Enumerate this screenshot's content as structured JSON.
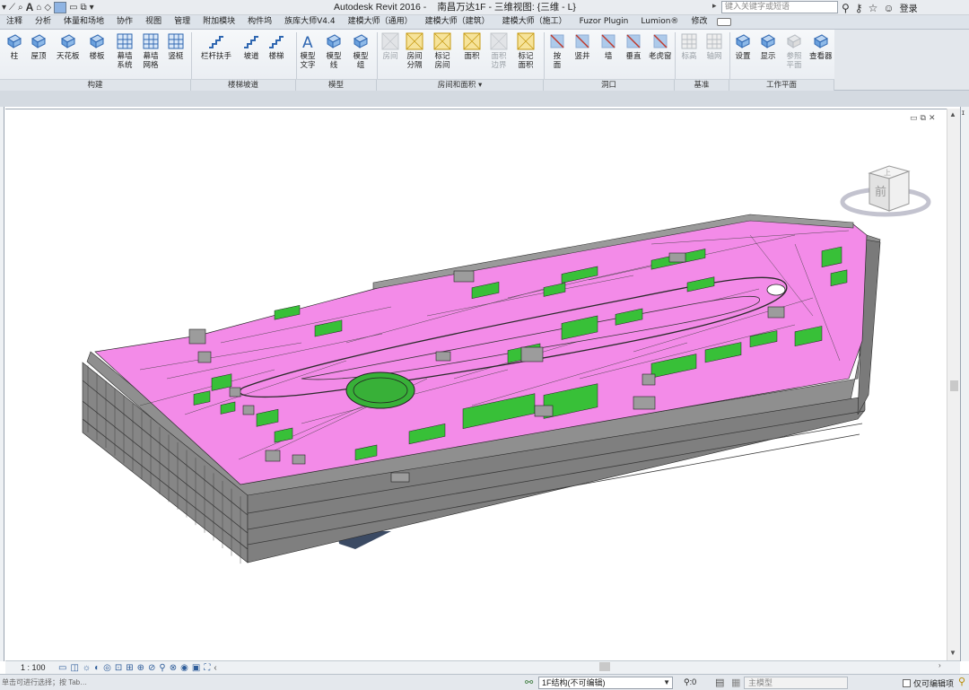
{
  "app": {
    "title": "Autodesk Revit 2016 -",
    "document": "南昌万达1F - 三维视图: {三维 - L}",
    "search_placeholder": "键入关键字或短语",
    "login_label": "登录"
  },
  "tabs": [
    "注释",
    "分析",
    "体量和场地",
    "协作",
    "视图",
    "管理",
    "附加模块",
    "构件坞",
    "族库大师V4.4",
    "建模大师（通用）",
    "建模大师（建筑）",
    "建模大师（施工）",
    "Fuzor Plugin",
    "Lumion®",
    "修改"
  ],
  "ribbon": {
    "tools": [
      {
        "label": "柱",
        "icon": "column-icon",
        "disabled": false
      },
      {
        "label": "屋顶",
        "icon": "roof-icon",
        "disabled": false
      },
      {
        "label": "天花板",
        "icon": "ceiling-icon",
        "disabled": false
      },
      {
        "label": "楼板",
        "icon": "floor-icon",
        "disabled": false
      },
      {
        "label": "幕墙\n系统",
        "icon": "curtain-system-icon",
        "disabled": false
      },
      {
        "label": "幕墙\n网格",
        "icon": "curtain-grid-icon",
        "disabled": false
      },
      {
        "label": "竖梃",
        "icon": "mullion-icon",
        "disabled": false
      },
      {
        "label": "栏杆扶手",
        "icon": "railing-icon",
        "disabled": false
      },
      {
        "label": "坡道",
        "icon": "ramp-icon",
        "disabled": false
      },
      {
        "label": "楼梯",
        "icon": "stair-icon",
        "disabled": false
      },
      {
        "label": "模型\n文字",
        "icon": "model-text-icon",
        "disabled": false
      },
      {
        "label": "模型\n线",
        "icon": "model-line-icon",
        "disabled": false
      },
      {
        "label": "模型\n组",
        "icon": "model-group-icon",
        "disabled": false
      },
      {
        "label": "房间",
        "icon": "room-icon",
        "disabled": true
      },
      {
        "label": "房间\n分隔",
        "icon": "room-separator-icon",
        "disabled": false
      },
      {
        "label": "标记\n房间",
        "icon": "tag-room-icon",
        "disabled": false
      },
      {
        "label": "面积",
        "icon": "area-icon",
        "disabled": false
      },
      {
        "label": "面积\n边界",
        "icon": "area-boundary-icon",
        "disabled": true
      },
      {
        "label": "标记\n面积",
        "icon": "tag-area-icon",
        "disabled": false
      },
      {
        "label": "按\n面",
        "icon": "by-face-icon",
        "disabled": false
      },
      {
        "label": "竖井",
        "icon": "shaft-icon",
        "disabled": false
      },
      {
        "label": "墙",
        "icon": "wall-opening-icon",
        "disabled": false
      },
      {
        "label": "垂直",
        "icon": "vertical-opening-icon",
        "disabled": false
      },
      {
        "label": "老虎窗",
        "icon": "dormer-icon",
        "disabled": false
      },
      {
        "label": "标高",
        "icon": "level-icon",
        "disabled": true
      },
      {
        "label": "轴网",
        "icon": "grid-icon",
        "disabled": true
      },
      {
        "label": "设置",
        "icon": "set-workplane-icon",
        "disabled": false
      },
      {
        "label": "显示",
        "icon": "show-workplane-icon",
        "disabled": false
      },
      {
        "label": "参照\n平面",
        "icon": "ref-plane-icon",
        "disabled": true
      },
      {
        "label": "查看器",
        "icon": "viewer-icon",
        "disabled": false
      }
    ],
    "groups": [
      "构建",
      "楼梯坡道",
      "模型",
      "房间和面积 ▾",
      "洞口",
      "基准",
      "工作平面"
    ]
  },
  "viewcube": {
    "face_label": "前",
    "top_label": "上"
  },
  "view_control": {
    "scale": "1 : 100"
  },
  "status": {
    "left_text": "单击可进行选择；按 Tab…",
    "workset": "1F结构(不可编辑)",
    "zero": ":0",
    "model": "主模型",
    "editable_only": "仅可编辑项"
  },
  "colors": {
    "floor": "#f38be8",
    "rooms": "#38c038",
    "walls": "#8a8a8a"
  }
}
